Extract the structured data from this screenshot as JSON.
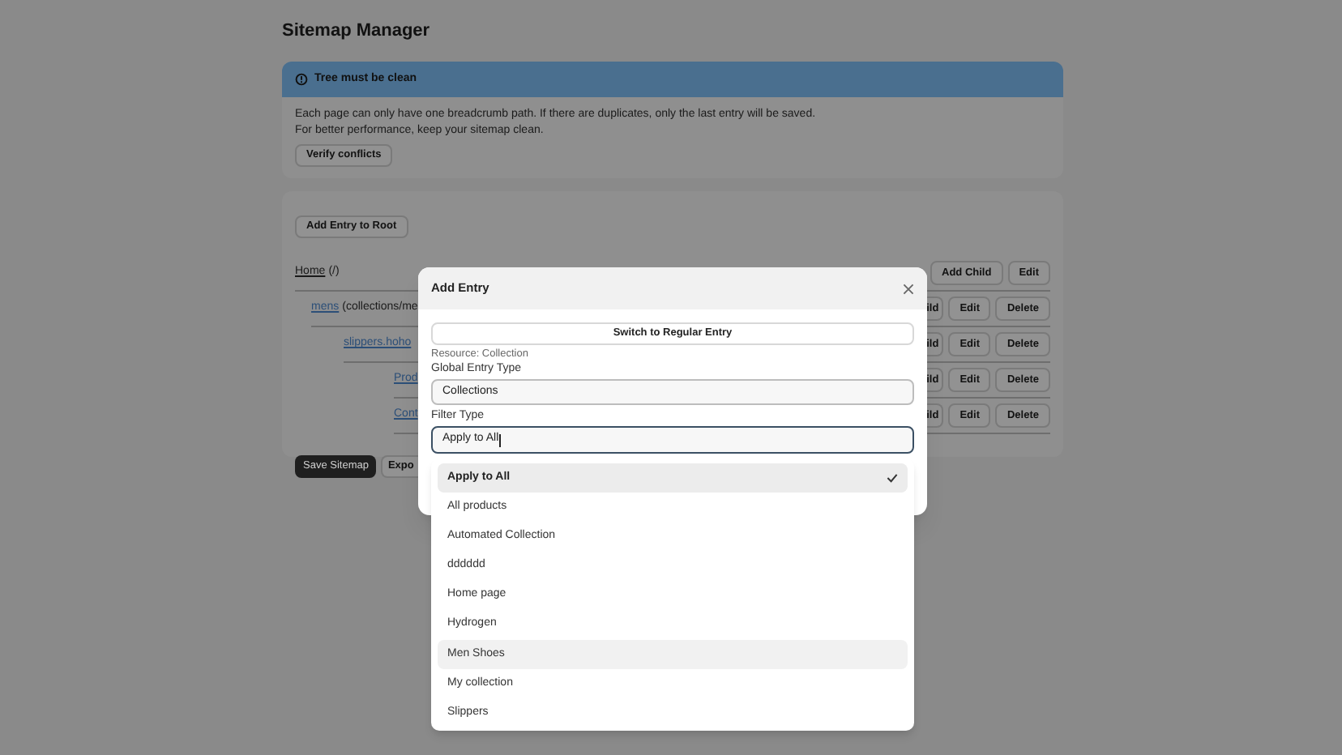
{
  "page": {
    "title": "Sitemap Manager"
  },
  "banner": {
    "title": "Tree must be clean",
    "lines": [
      "Each page can only have one breadcrumb path. If there are duplicates, only the last entry will be saved.",
      "For better performance, keep your sitemap clean."
    ],
    "button": "Verify conflicts"
  },
  "tree": {
    "add_root_button": "Add Entry to Root",
    "rows": [
      {
        "link": "Home",
        "path": "(/)",
        "buttons": [
          "Add Child",
          "Edit"
        ],
        "children": [
          {
            "link": "mens",
            "path": "(collections/me",
            "buttons": [
              "ild",
              "Edit",
              "Delete"
            ],
            "children": [
              {
                "link": "slippers.hoho",
                "buttons": [
                  "ild",
                  "Edit",
                  "Delete"
                ],
                "children": [
                  {
                    "link": "Prod",
                    "buttons": [
                      "ild",
                      "Edit",
                      "Delete"
                    ]
                  },
                  {
                    "link": "Cont",
                    "buttons": [
                      "ild",
                      "Edit",
                      "Delete"
                    ]
                  }
                ]
              }
            ]
          }
        ]
      }
    ],
    "save_button": "Save Sitemap",
    "export_button": "Expo"
  },
  "modal": {
    "title": "Add Entry",
    "switch_button": "Switch to Regular Entry",
    "resource": "Resource: Collection",
    "global_label": "Global Entry Type",
    "global_value": "Collections",
    "filter_label": "Filter Type",
    "filter_value": "Apply to All",
    "options": [
      {
        "label": "Apply to All",
        "selected": true,
        "highlighted": false
      },
      {
        "label": "All products",
        "selected": false,
        "highlighted": false
      },
      {
        "label": "Automated Collection",
        "selected": false,
        "highlighted": false
      },
      {
        "label": "dddddd",
        "selected": false,
        "highlighted": false
      },
      {
        "label": "Home page",
        "selected": false,
        "highlighted": false
      },
      {
        "label": "Hydrogen",
        "selected": false,
        "highlighted": false
      },
      {
        "label": "Men Shoes",
        "selected": false,
        "highlighted": true
      },
      {
        "label": "My collection",
        "selected": false,
        "highlighted": false
      },
      {
        "label": "Slippers",
        "selected": false,
        "highlighted": false
      }
    ]
  }
}
